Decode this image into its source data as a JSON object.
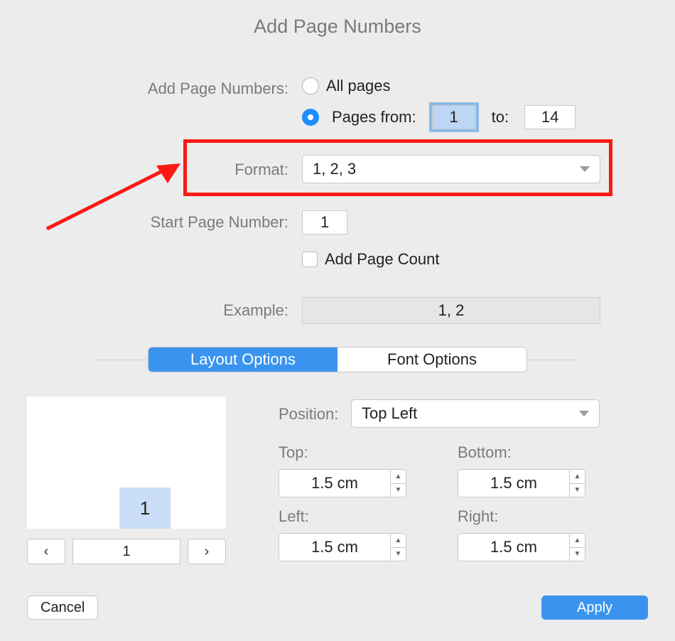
{
  "title": "Add Page Numbers",
  "radios": {
    "label": "Add Page Numbers:",
    "all": "All pages",
    "range": "Pages from:",
    "to": "to:",
    "from_value": "1",
    "to_value": "14"
  },
  "format": {
    "label": "Format:",
    "value": "1, 2, 3"
  },
  "start": {
    "label": "Start Page Number:",
    "value": "1"
  },
  "addcount": {
    "label": "Add Page Count"
  },
  "example": {
    "label": "Example:",
    "value": "1, 2"
  },
  "tabs": {
    "layout": "Layout Options",
    "font": "Font Options"
  },
  "preview": {
    "token": "1",
    "page": "1",
    "prev": "‹",
    "next": "›"
  },
  "position": {
    "label": "Position:",
    "value": "Top Left"
  },
  "margins": {
    "top_label": "Top:",
    "bottom_label": "Bottom:",
    "left_label": "Left:",
    "right_label": "Right:",
    "top": "1.5 cm",
    "bottom": "1.5 cm",
    "left": "1.5 cm",
    "right": "1.5 cm",
    "stepper_up": "▲",
    "stepper_down": "▼"
  },
  "buttons": {
    "cancel": "Cancel",
    "apply": "Apply"
  }
}
